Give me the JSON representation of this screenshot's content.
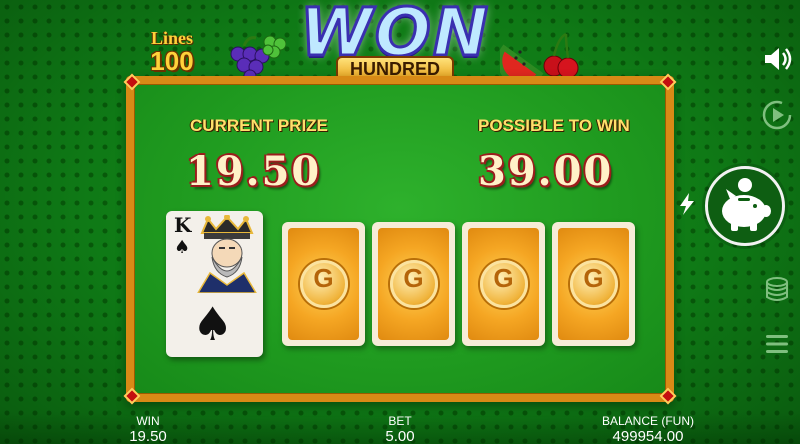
{
  "header": {
    "lines_label": "Lines",
    "lines_value": "100",
    "logo_title": "WON",
    "logo_subtitle": "HUNDRED"
  },
  "board": {
    "current_prize_label": "CURRENT PRIZE",
    "current_prize_value": "19.50",
    "possible_win_label": "POSSIBLE TO WIN",
    "possible_win_value": "39.00"
  },
  "cards": {
    "revealed": {
      "rank": "K",
      "suit": "♠"
    },
    "hidden": [
      {
        "symbol": "G"
      },
      {
        "symbol": "G"
      },
      {
        "symbol": "G"
      },
      {
        "symbol": "G"
      }
    ]
  },
  "controls": [
    "sound-icon",
    "autoplay-icon",
    "lightning-icon",
    "piggy-bank-icon",
    "coins-stack-icon",
    "menu-icon"
  ],
  "footer": {
    "win_label": "WIN",
    "win_value": "19.50",
    "bet_label": "BET",
    "bet_value": "5.00",
    "balance_label": "BALANCE (FUN)",
    "balance_value": "499954.00"
  },
  "colors": {
    "background": "#0f7a16",
    "board_frame": "#d88a16",
    "prize_label": "#ffe06a",
    "prize_value": "#fff2c8",
    "card_back": "#f5a623"
  }
}
